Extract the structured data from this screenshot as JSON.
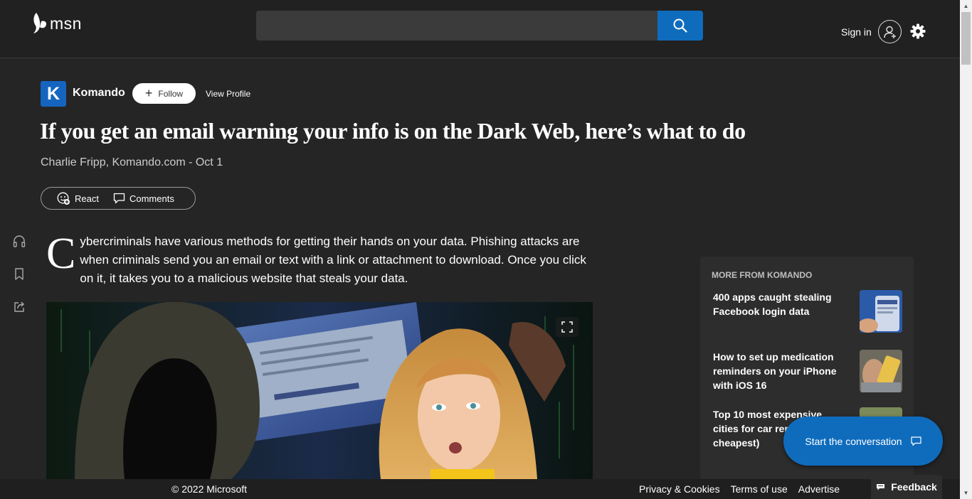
{
  "header": {
    "logo_text": "msn",
    "search": {
      "placeholder": "",
      "value": ""
    },
    "signin_label": "Sign in"
  },
  "publisher": {
    "logo_letter": "K",
    "name": "Komando",
    "follow_label": "Follow",
    "view_profile_label": "View Profile"
  },
  "article": {
    "headline": "If you get an email warning your info is on the Dark Web, here’s what to do",
    "byline": "Charlie Fripp, Komando.com - Oct 1",
    "react_label": "React",
    "comments_label": "Comments",
    "dropcap": "C",
    "intro": "ybercriminals have various methods for getting their hands on your data. Phishing attacks are when criminals send you an email or text with a link or attachment to download. Once you click on it, it takes you to a malicious website that steals your data."
  },
  "side_actions": [
    "headphones-icon",
    "bookmark-icon",
    "share-icon"
  ],
  "more_from": {
    "title": "MORE FROM KOMANDO",
    "stories": [
      {
        "title": "400 apps caught stealing Facebook login data"
      },
      {
        "title": "How to set up medication reminders on your iPhone with iOS 16"
      },
      {
        "title": "Top 10 most expensive cities for car repair (and cheapest)"
      }
    ]
  },
  "conversation": {
    "label": "Start the conversation"
  },
  "footer": {
    "copyright": "© 2022 Microsoft",
    "links": [
      "Privacy & Cookies",
      "Terms of use",
      "Advertise"
    ],
    "feedback_label": "Feedback"
  },
  "colors": {
    "accent": "#0f6cbd",
    "background": "#252526",
    "header": "#212121"
  }
}
